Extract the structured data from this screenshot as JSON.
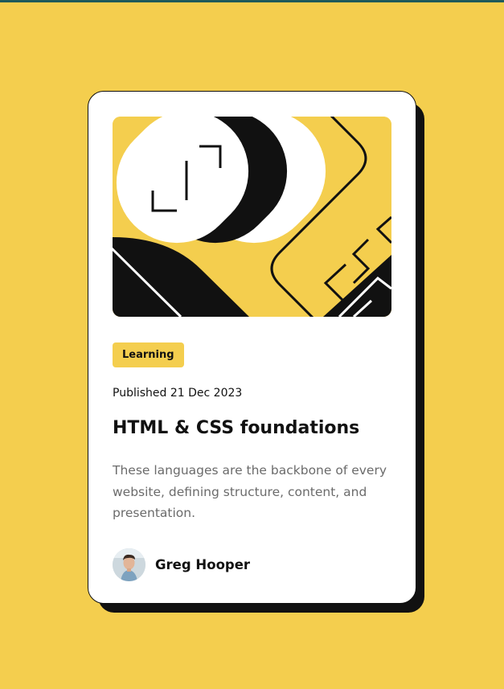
{
  "card": {
    "tag": "Learning",
    "published": "Published 21 Dec 2023",
    "title": "HTML & CSS foundations",
    "description": "These languages are the backbone of every website, defining structure, content, and presentation.",
    "author": {
      "name": "Greg Hooper",
      "avatar_icon": "avatar-photo"
    }
  },
  "colors": {
    "background": "#F4CE4E",
    "card": "#FFFFFF",
    "ink": "#111111",
    "muted_text": "#6B6B6B"
  }
}
